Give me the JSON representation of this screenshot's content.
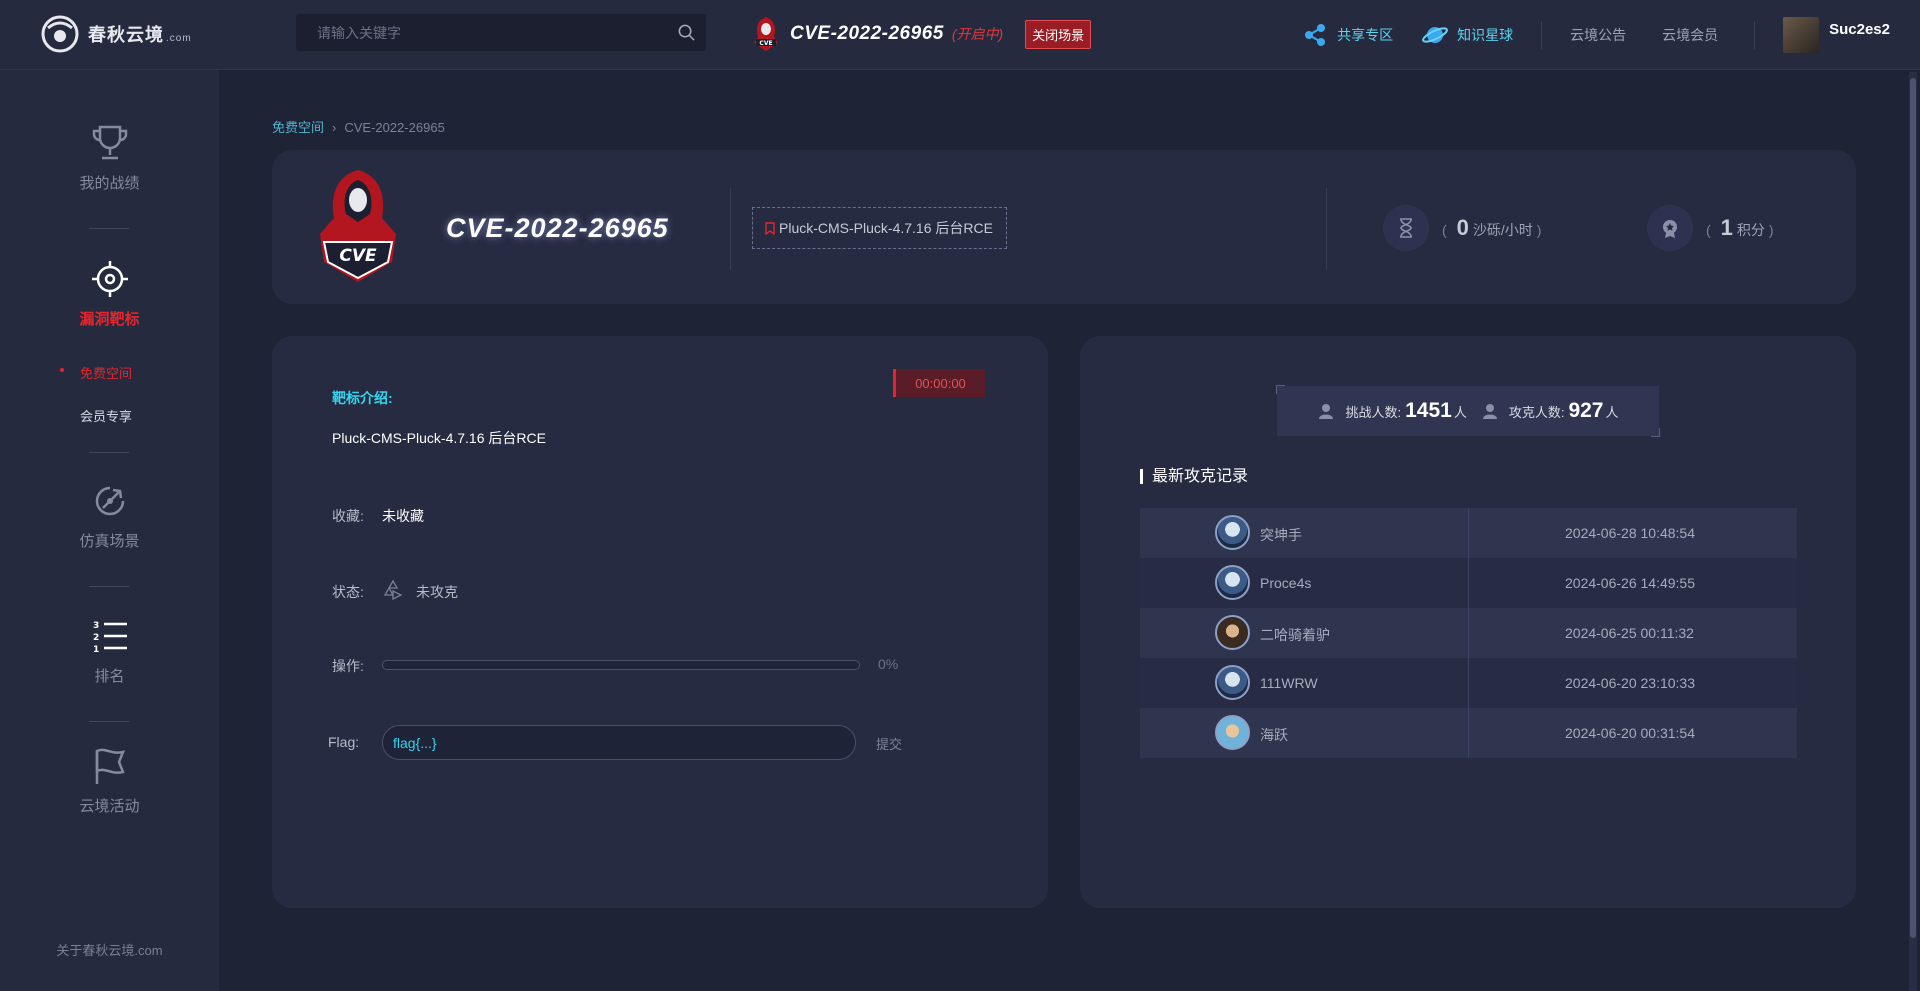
{
  "topbar": {
    "logo_text": "春秋云境",
    "logo_suffix": ".com",
    "search_placeholder": "请输入关键字",
    "scene_title": "CVE-2022-26965",
    "scene_status": "(开启中)",
    "scene_close_label": "关闭场景",
    "nav_links": [
      {
        "label": "共享专区",
        "icon": "share-icon"
      },
      {
        "label": "知识星球",
        "icon": "planet-icon"
      }
    ],
    "nav_texts": [
      "云境公告",
      "云境会员"
    ],
    "username": "Suc2es2"
  },
  "sidebar": {
    "items": [
      {
        "label": "我的战绩",
        "icon": "trophy-icon"
      },
      {
        "label": "漏洞靶标",
        "icon": "target-icon"
      },
      {
        "label": "仿真场景",
        "icon": "rocket-icon"
      },
      {
        "label": "排名",
        "icon": "ranking-list-icon"
      },
      {
        "label": "云境活动",
        "icon": "flag-icon"
      }
    ],
    "sub_items": [
      "免费空间",
      "会员专享"
    ],
    "footer": "关于春秋云境.com"
  },
  "breadcrumb": {
    "parent": "免费空间",
    "current": "CVE-2022-26965"
  },
  "header": {
    "title": "CVE-2022-26965",
    "tag": "Pluck-CMS-Pluck-4.7.16 后台RCE",
    "rate_value": "0",
    "rate_unit": "沙砾/小时",
    "score_value": "1",
    "score_unit": "积分",
    "paren_open": "(",
    "paren_close": ")"
  },
  "detail": {
    "timer": "00:00:00",
    "intro_label": "靶标介绍:",
    "intro_text": "Pluck-CMS-Pluck-4.7.16 后台RCE",
    "favorite_label": "收藏:",
    "favorite_value": "未收藏",
    "status_label": "状态:",
    "status_value": "未攻克",
    "operation_label": "操作:",
    "progress_percent": 0,
    "progress_text": "0%",
    "flag_label": "Flag:",
    "flag_placeholder": "flag{...}",
    "submit_label": "提交"
  },
  "stats": {
    "challenge_label": "挑战人数:",
    "challenge_count": "1451",
    "solved_label": "攻克人数:",
    "solved_count": "927",
    "person_unit": "人",
    "records_title": "最新攻克记录",
    "records": [
      {
        "name": "突坤手",
        "time": "2024-06-28 10:48:54"
      },
      {
        "name": "Proce4s",
        "time": "2024-06-26 14:49:55"
      },
      {
        "name": "二哈骑着驴",
        "time": "2024-06-25 00:11:32"
      },
      {
        "name": "111WRW",
        "time": "2024-06-20 23:10:33"
      },
      {
        "name": "海跃",
        "time": "2024-06-20 00:31:54"
      }
    ]
  },
  "colors": {
    "accent": "#35d4ee",
    "danger": "#e5252d",
    "background": "#1f2336",
    "panel": "#262b42"
  }
}
